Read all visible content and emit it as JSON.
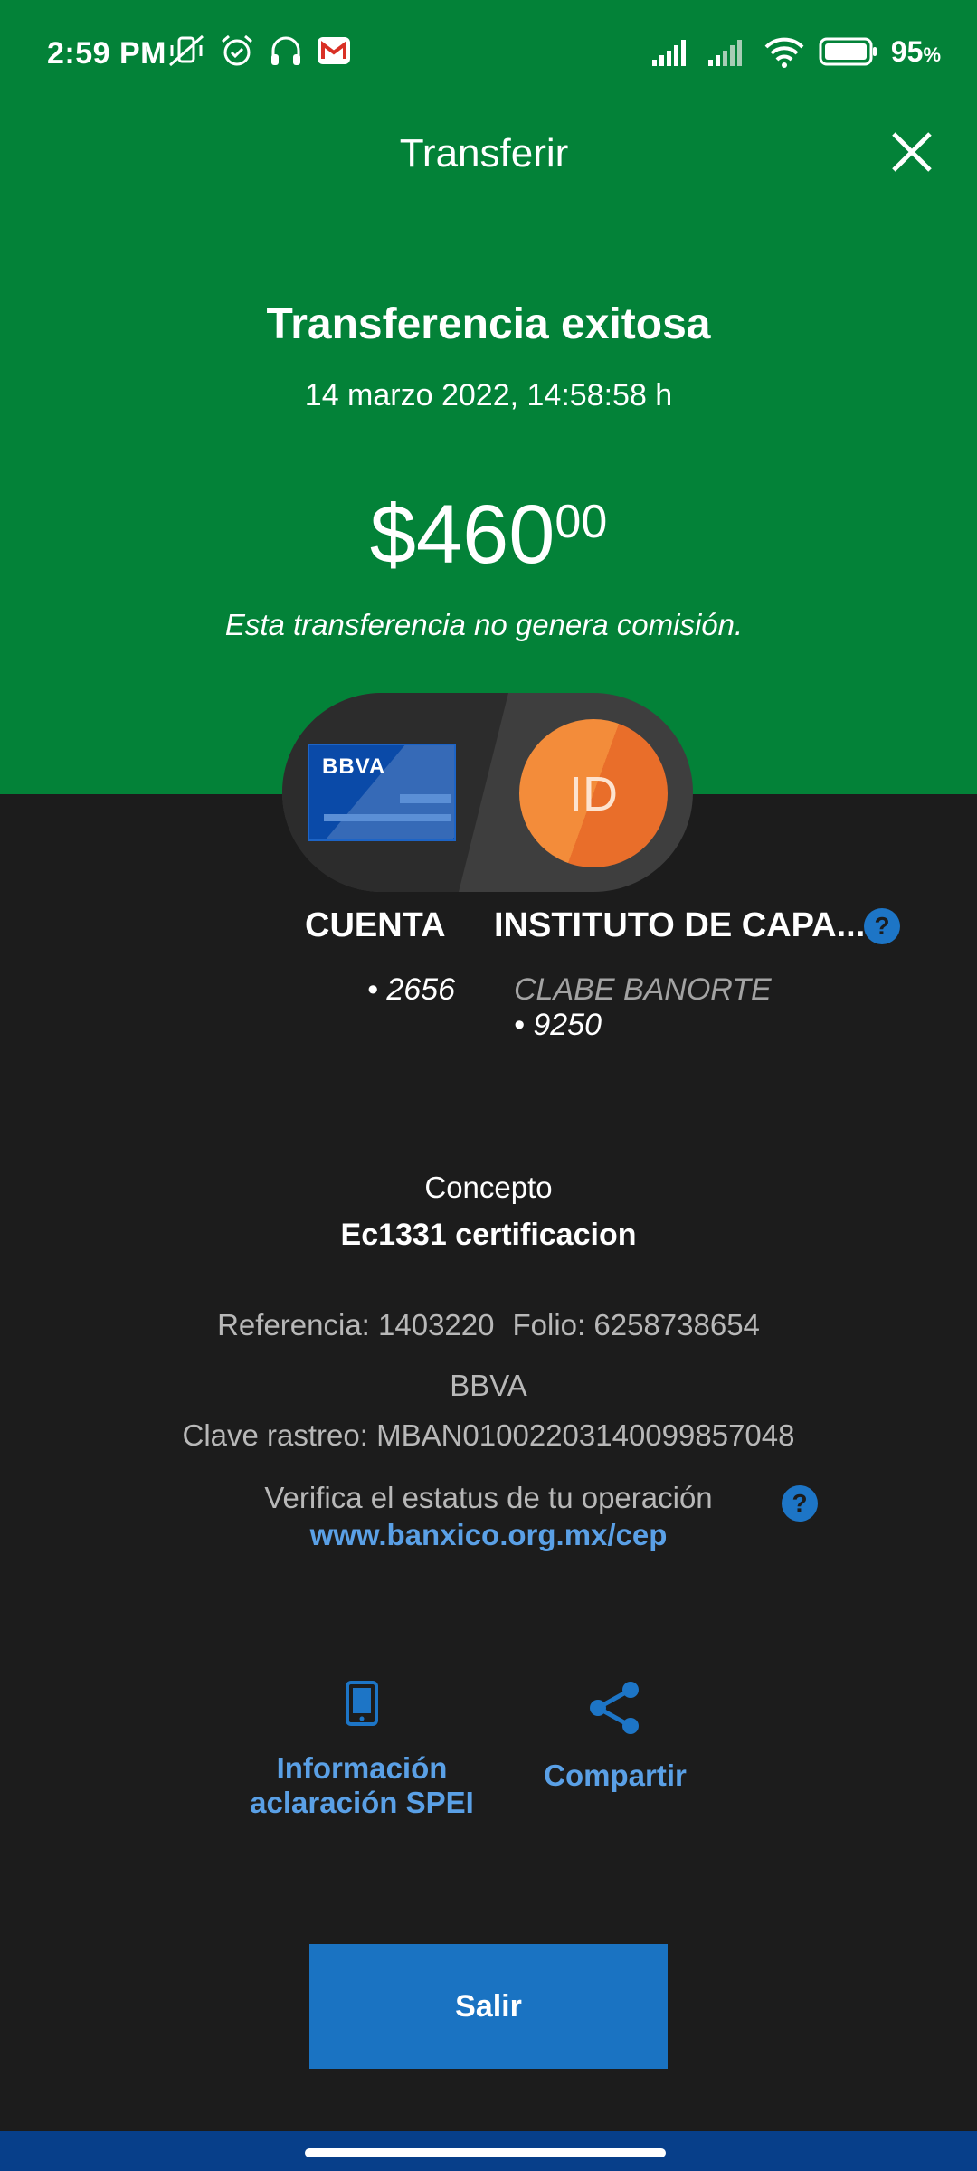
{
  "status_bar": {
    "time": "2:59 PM",
    "battery_pct": "95",
    "battery_unit": "%",
    "icons": [
      "vibrate-off-icon",
      "alarm-icon",
      "headset-icon",
      "gmail-icon",
      "signal-icon",
      "wifi-icon",
      "battery-icon"
    ]
  },
  "header": {
    "title": "Transferir"
  },
  "result": {
    "title": "Transferencia exitosa",
    "date": "14 marzo 2022, 14:58:58 h",
    "amount_main": "$460",
    "amount_cents": "00",
    "commission_note": "Esta transferencia no genera comisión."
  },
  "from_account": {
    "card_logo": "BBVA",
    "label": "CUENTA",
    "number": "• 2656"
  },
  "to_account": {
    "initials": "ID",
    "label": "INSTITUTO DE CAPA...",
    "bank": "CLABE BANORTE",
    "number": "• 9250"
  },
  "details": {
    "concept_label": "Concepto",
    "concept_value": "Ec1331 certificacion",
    "reference": "Referencia: 1403220",
    "folio": "Folio: 6258738654",
    "bank": "BBVA",
    "tracking_key": "Clave rastreo: MBAN01002203140099857048",
    "verify_text": "Verifica el estatus de tu operación",
    "verify_link": "www.banxico.org.mx/cep"
  },
  "actions": {
    "spei_line1": "Información",
    "spei_line2": "aclaración SPEI",
    "share": "Compartir"
  },
  "buttons": {
    "exit": "Salir"
  },
  "colors": {
    "header_green": "#038238",
    "background": "#1c1c1c",
    "accent_blue": "#1a73c2",
    "link_blue": "#5aa0e6",
    "nav_blue": "#073f8a"
  }
}
